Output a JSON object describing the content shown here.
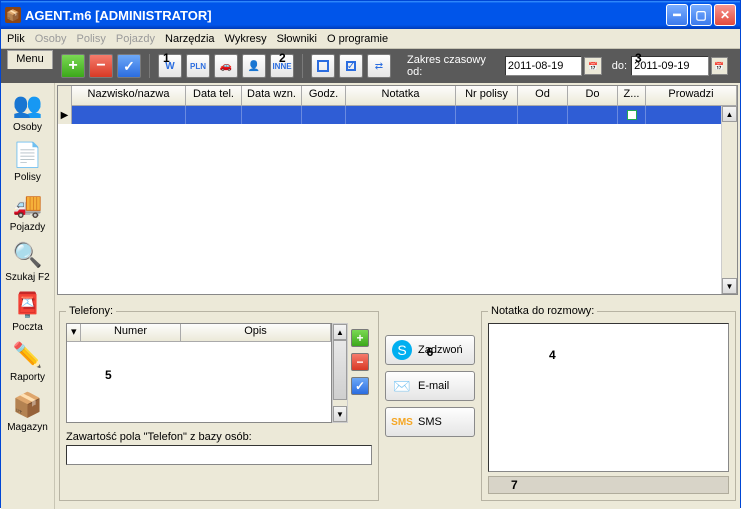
{
  "window": {
    "title": "AGENT.m6 [ADMINISTRATOR]"
  },
  "menubar": {
    "plik": "Plik",
    "osoby": "Osoby",
    "polisy": "Polisy",
    "pojazdy": "Pojazdy",
    "narzedzia": "Narzędzia",
    "wykresy": "Wykresy",
    "slowniki": "Słowniki",
    "oprogramie": "O programie"
  },
  "menu_tab": "Menu",
  "toolbar": {
    "filter_w": "W",
    "filter_pln": "PLN",
    "filter_inne": "INNE"
  },
  "range": {
    "label_from": "Zakres czasowy od:",
    "date_from": "2011-08-19",
    "label_to": "do:",
    "date_to": "2011-09-19"
  },
  "sidebar": {
    "osoby": "Osoby",
    "polisy": "Polisy",
    "pojazdy": "Pojazdy",
    "szukaj": "Szukaj F2",
    "poczta": "Poczta",
    "raporty": "Raporty",
    "magazyn": "Magazyn"
  },
  "grid": {
    "cols": {
      "nazwisko": "Nazwisko/nazwa",
      "datatel": "Data tel.",
      "datawzn": "Data wzn.",
      "godz": "Godz.",
      "notatka": "Notatka",
      "nrpolisy": "Nr polisy",
      "od": "Od",
      "do": "Do",
      "z": "Z...",
      "prowadzi": "Prowadzi"
    }
  },
  "telefony": {
    "legend": "Telefony:",
    "col_numer": "Numer",
    "col_opis": "Opis",
    "zaw_label": "Zawartość pola \"Telefon\" z bazy osób:"
  },
  "comm": {
    "zadzwon": "Zadzwoń",
    "email": "E-mail",
    "sms": "SMS"
  },
  "notatka": {
    "legend": "Notatka do rozmowy:"
  },
  "hints": {
    "h1": "1",
    "h2": "2",
    "h3": "3",
    "h4": "4",
    "h5": "5",
    "h6": "6",
    "h7": "7"
  }
}
